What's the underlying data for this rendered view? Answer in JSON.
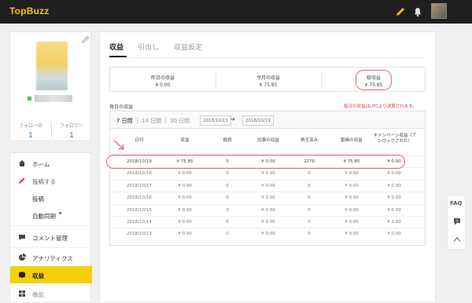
{
  "app": {
    "logo": "TopBuzz"
  },
  "topbar": {
    "icons": [
      "pencil-icon",
      "bell-icon"
    ],
    "accent": "#f5c400"
  },
  "profile": {
    "following_label": "フォロー中",
    "following_count": "1",
    "followers_label": "フォロワー",
    "followers_count": "1"
  },
  "sidebar": {
    "items": [
      {
        "label": "ホーム",
        "icon": "home-icon"
      },
      {
        "label": "投稿する",
        "icon": "pencil-icon"
      },
      {
        "label": "投稿"
      },
      {
        "label": "自動同期"
      },
      {
        "label": "コメント管理",
        "icon": "comment-icon"
      },
      {
        "label": "アナリティクス",
        "icon": "pie-chart-icon"
      },
      {
        "label": "収益",
        "icon": "coins-icon"
      },
      {
        "label": "機能",
        "icon": "grid-icon"
      }
    ],
    "active_color": "#f7cf0a"
  },
  "tabs": [
    "収益",
    "引出し",
    "収益設定"
  ],
  "summary": [
    {
      "title": "昨日の収益",
      "value": "¥ 0.00"
    },
    {
      "title": "今月の収益",
      "value": "¥ 75.85"
    },
    {
      "title": "総収益",
      "value": "¥ 75.85"
    }
  ],
  "daily": {
    "title": "毎日の収益",
    "note": "毎日の収益はUTCより決算されます。",
    "periods": [
      "7 日間",
      "14 日間",
      "30 日間"
    ],
    "date_from": "2018/10/13",
    "date_to": "2018/10/19"
  },
  "table": {
    "columns": [
      "日付",
      "収益",
      "既読",
      "記事の収益",
      "再生済み",
      "動画の収益",
      "キャンペーン収益（アンロックされた）"
    ],
    "rows": [
      [
        "2018/10/19",
        "¥ 75.85",
        "0",
        "¥ 0.00",
        "2276",
        "¥ 75.85",
        "¥ 0.00"
      ],
      [
        "2018/10/18",
        "¥ 0.00",
        "0",
        "¥ 0.00",
        "0",
        "¥ 0.00",
        "¥ 0.00"
      ],
      [
        "2018/10/17",
        "¥ 0.00",
        "0",
        "¥ 0.00",
        "0",
        "¥ 0.00",
        "¥ 0.00"
      ],
      [
        "2018/10/16",
        "¥ 0.00",
        "0",
        "¥ 0.00",
        "0",
        "¥ 0.00",
        "¥ 0.00"
      ],
      [
        "2018/10/15",
        "¥ 0.00",
        "0",
        "¥ 0.00",
        "0",
        "¥ 0.00",
        "¥ 0.00"
      ],
      [
        "2018/10/14",
        "¥ 0.00",
        "0",
        "¥ 0.00",
        "0",
        "¥ 0.00",
        "¥ 0.00"
      ],
      [
        "2018/10/13",
        "¥ 0.00",
        "0",
        "¥ 0.00",
        "0",
        "¥ 0.00",
        "¥ 0.00"
      ]
    ]
  },
  "float_panel": {
    "faq_label": "FAQ"
  }
}
